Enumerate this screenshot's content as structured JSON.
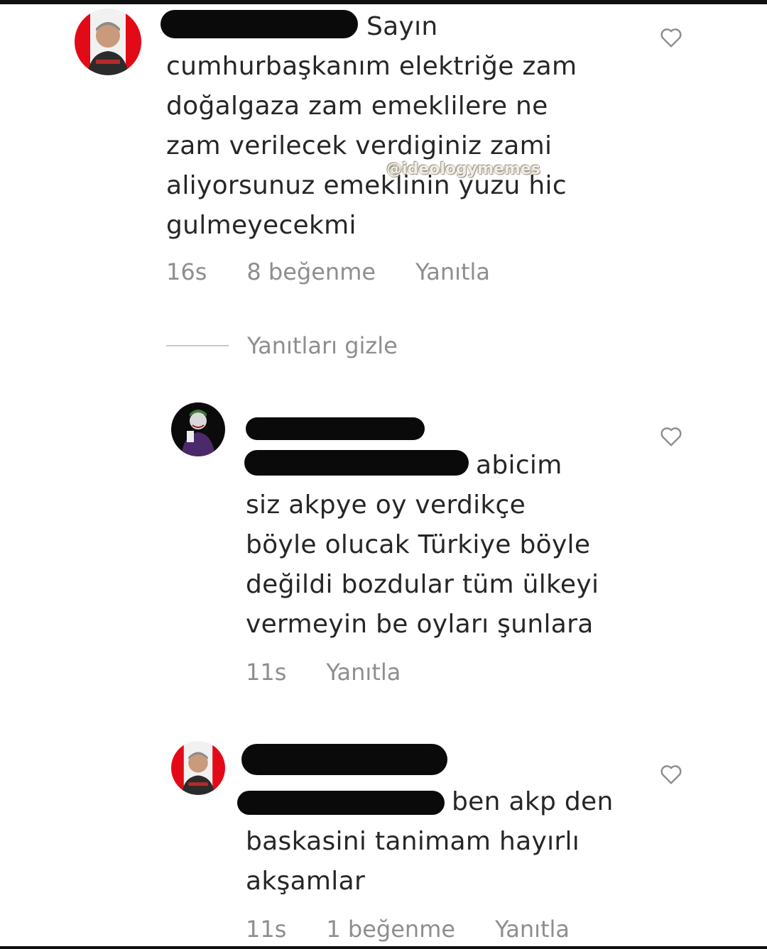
{
  "colors": {
    "text": "#262626",
    "meta": "#8e8e8e",
    "redaction": "#0a0a0a",
    "flag_red": "#e30a17"
  },
  "watermark": "@ideologymemes",
  "comments": [
    {
      "text": "Sayın\ncumhurbaşkanım  elektriğe  zam\ndoğalgaza  zam emeklilere ne\nzam verilecek verdiginiz zami\naliyorsunuz emeklinin yuzu hic\ngulmeyecekmi",
      "time": "16s",
      "likes": "8 beğenme",
      "reply": "Yanıtla",
      "icons": {
        "avatar": "avatar-man-flag-icon",
        "like": "heart-outline-icon"
      }
    },
    {
      "text": "abicim\nsiz akpye oy verdikçe\nböyle olucak Türkiye böyle\ndeğildi bozdular tüm ülkeyi\nvermeyin be oyları şunlara",
      "time": "11s",
      "reply": "Yanıtla",
      "icons": {
        "avatar": "avatar-joker-icon",
        "like": "heart-outline-icon"
      }
    },
    {
      "text": "ben akp den\nbaskasini tanimam hayırlı\nakşamlar",
      "time": "11s",
      "likes": "1 beğenme",
      "reply": "Yanıtla",
      "icons": {
        "avatar": "avatar-man-flag-icon",
        "like": "heart-outline-icon"
      }
    }
  ],
  "replies_toggle": {
    "label": "Yanıtları gizle"
  }
}
